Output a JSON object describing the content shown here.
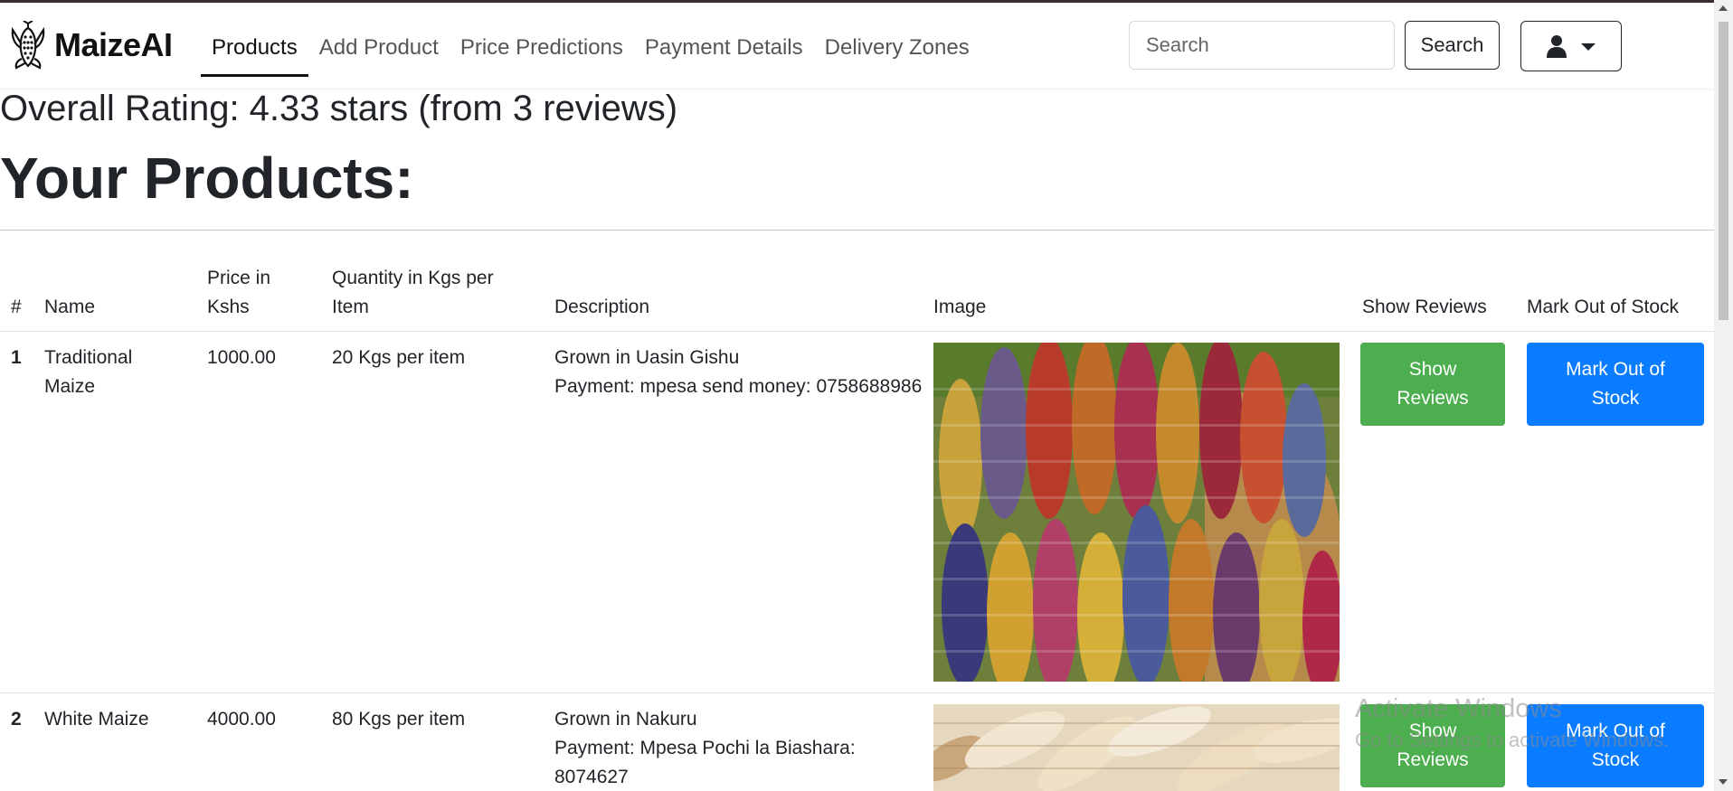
{
  "navbar": {
    "brand": "MaizeAI",
    "nav_items": [
      "Products",
      "Add Product",
      "Price Predictions",
      "Payment Details",
      "Delivery Zones"
    ],
    "active_item": "Products",
    "search_placeholder": "Search",
    "search_button": "Search"
  },
  "summary": {
    "rating_text": "Overall Rating: 4.33 stars (from 3 reviews)",
    "heading": "Your Products:"
  },
  "table": {
    "headers": {
      "index": "#",
      "name": "Name",
      "price_line1": "Price in",
      "price_line2": "Kshs",
      "quantity_line1": "Quantity in Kgs per",
      "quantity_line2": "Item",
      "description": "Description",
      "image": "Image",
      "show_reviews": "Show Reviews",
      "mark_out": "Mark Out of Stock"
    },
    "rows": [
      {
        "num": "1",
        "name_line1": "Traditional",
        "name_line2": "Maize",
        "price": "1000.00",
        "quantity": "20 Kgs per item",
        "desc_line1": "Grown in Uasin Gishu",
        "desc_line2": "Payment: mpesa send money: 0758688986",
        "desc_line3": "",
        "reviews_line1": "Show",
        "reviews_line2": "Reviews",
        "stock_line1": "Mark Out of",
        "stock_line2": "Stock"
      },
      {
        "num": "2",
        "name_line1": "White Maize",
        "name_line2": "",
        "price": "4000.00",
        "quantity": "80 Kgs per item",
        "desc_line1": "Grown in Nakuru",
        "desc_line2": "Payment: Mpesa Pochi la Biashara:",
        "desc_line3": "8074627",
        "reviews_line1": "Show",
        "reviews_line2": "Reviews",
        "stock_line1": "Mark Out of",
        "stock_line2": "Stock"
      }
    ]
  },
  "watermark": {
    "line1": "Activate Windows",
    "line2": "Go to Settings to activate Windows."
  },
  "colors": {
    "show_reviews_button": "#4cae4f",
    "mark_out_button": "#0a7cff",
    "text": "#212529"
  }
}
